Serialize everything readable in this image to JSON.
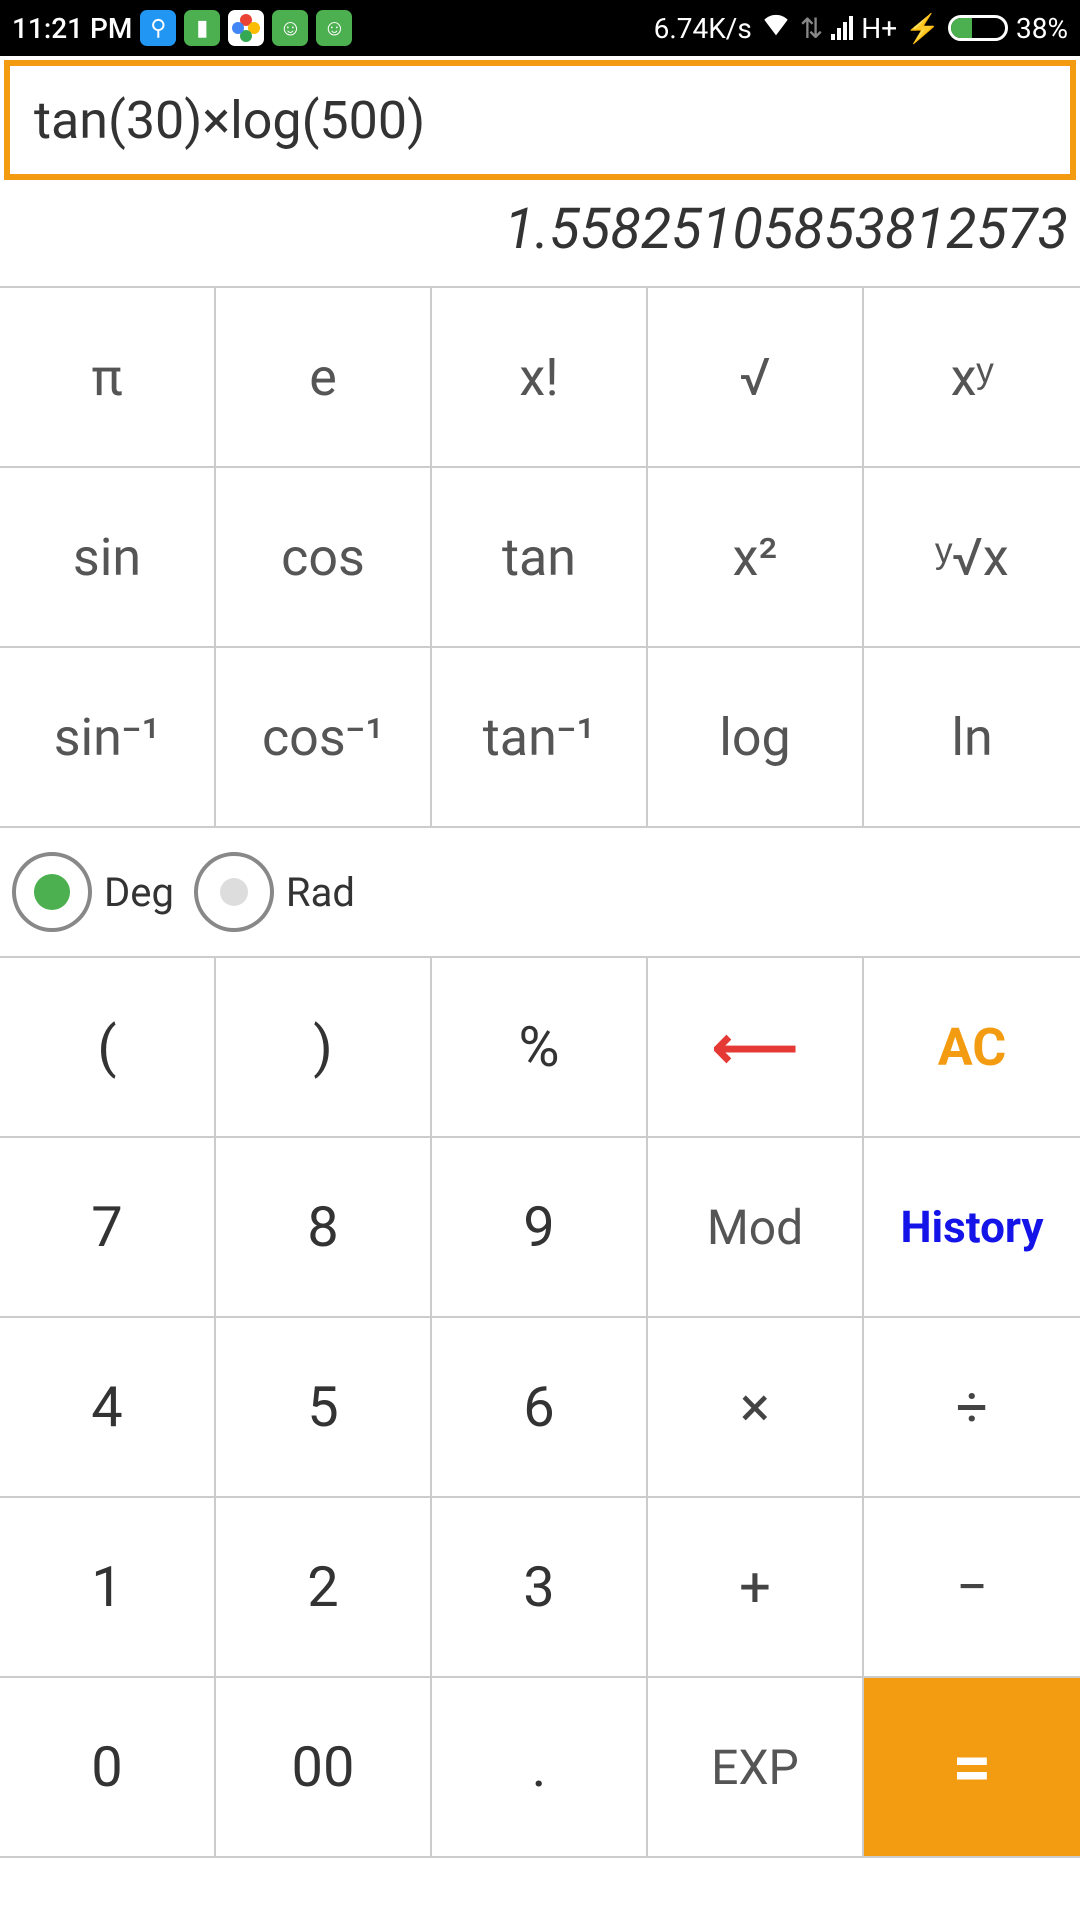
{
  "status_bar": {
    "time": "11:21 PM",
    "data_speed": "6.74K/s",
    "network": "H+",
    "battery_percent": "38%"
  },
  "calculator": {
    "expression": "tan(30)×log(500)",
    "result": "1.55825105853812573",
    "sci_buttons": {
      "pi": "π",
      "e": "e",
      "factorial": "x!",
      "sqrt": "√",
      "power": "xʸ",
      "sin": "sin",
      "cos": "cos",
      "tan": "tan",
      "square": "x²",
      "yroot": "ʸ√x",
      "asin": "sin⁻¹",
      "acos": "cos⁻¹",
      "atan": "tan⁻¹",
      "log": "log",
      "ln": "ln"
    },
    "angle_mode": {
      "deg": "Deg",
      "rad": "Rad",
      "selected": "deg"
    },
    "buttons": {
      "lparen": "(",
      "rparen": ")",
      "percent": "%",
      "backspace": "←",
      "ac": "AC",
      "n7": "7",
      "n8": "8",
      "n9": "9",
      "mod": "Mod",
      "history": "History",
      "n4": "4",
      "n5": "5",
      "n6": "6",
      "multiply": "×",
      "divide": "÷",
      "n1": "1",
      "n2": "2",
      "n3": "3",
      "plus": "+",
      "minus": "−",
      "n0": "0",
      "n00": "00",
      "dot": ".",
      "exp": "EXP",
      "equals": "="
    }
  }
}
